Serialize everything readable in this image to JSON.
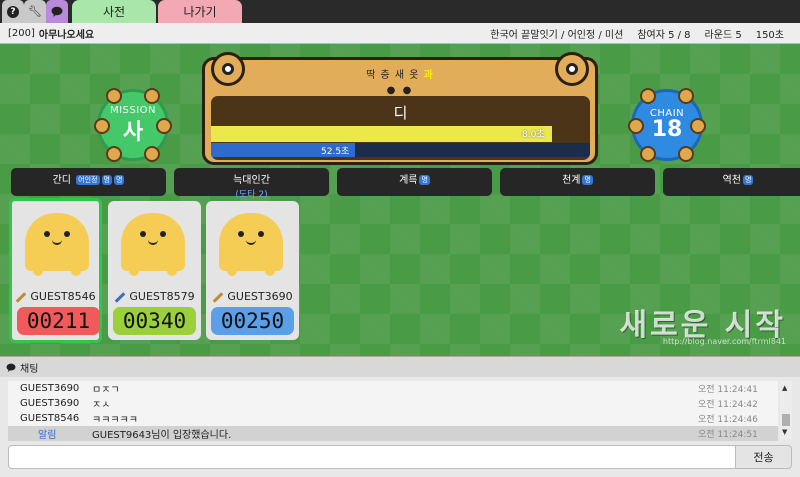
{
  "topbar": {
    "help_icon": "help-icon",
    "settings_icon": "wrench-icon",
    "chat_icon": "chat-bubble-icon",
    "tabs": [
      {
        "label": "사전",
        "color": "#a9e6a9"
      },
      {
        "label": "나가기",
        "color": "#f3a9b3"
      }
    ]
  },
  "room": {
    "id": "[200]",
    "title": "아무나오세요",
    "mode": "한국어 끝말잇기 / 어인정 / 미션",
    "players": "참여자 5 / 8",
    "round": "라운드 5",
    "time": "150초"
  },
  "game": {
    "hint_prefix": "딱 층 새 옷",
    "hint_highlight": "과",
    "dots": "● ●",
    "current_word": "디",
    "turn_time_label": "8.0초",
    "turn_time_fraction": 0.9,
    "round_time_label": "52.5초",
    "round_time_fraction": 0.38,
    "mission": {
      "label": "MISSION",
      "value": "사",
      "color": "#45c86a"
    },
    "chain": {
      "label": "CHAIN",
      "value": "18",
      "color": "#2f8be2"
    }
  },
  "history": [
    {
      "word": "간디",
      "tags": [
        "어인정",
        "명",
        "명"
      ],
      "sub": ""
    },
    {
      "word": "늑대인간",
      "tags": [],
      "sub": "(도타 2)"
    },
    {
      "word": "계륵",
      "tags": [
        "명"
      ],
      "sub": ""
    },
    {
      "word": "천계",
      "tags": [
        "명"
      ],
      "sub": ""
    },
    {
      "word": "역천",
      "tags": [
        "명"
      ],
      "sub": ""
    }
  ],
  "players": [
    {
      "name": "GUEST8546",
      "score": "00211",
      "score_color": "#f15a5a",
      "active": true,
      "pencil": "brown"
    },
    {
      "name": "GUEST8579",
      "score": "00340",
      "score_color": "#9bd03a",
      "active": false,
      "pencil": "blue"
    },
    {
      "name": "GUEST3690",
      "score": "00250",
      "score_color": "#5b9fe8",
      "active": false,
      "pencil": "brown"
    }
  ],
  "watermark": {
    "text": "새로운 시작",
    "url": "http://blog.naver.com/ftrml841"
  },
  "chat": {
    "header": "채팅",
    "messages": [
      {
        "user": "GUEST3690",
        "text": "ㅁㅈㄱ",
        "time": "오전 11:24:41",
        "system": false
      },
      {
        "user": "GUEST3690",
        "text": "ㅈㅅ",
        "time": "오전 11:24:42",
        "system": false
      },
      {
        "user": "GUEST8546",
        "text": "ㅋㅋㅋㅋㅋ",
        "time": "오전 11:24:46",
        "system": false
      },
      {
        "user": "알림",
        "text": "GUEST9643님이 입장했습니다.",
        "time": "오전 11:24:51",
        "system": true
      }
    ],
    "input_value": "",
    "send_label": "전송"
  }
}
